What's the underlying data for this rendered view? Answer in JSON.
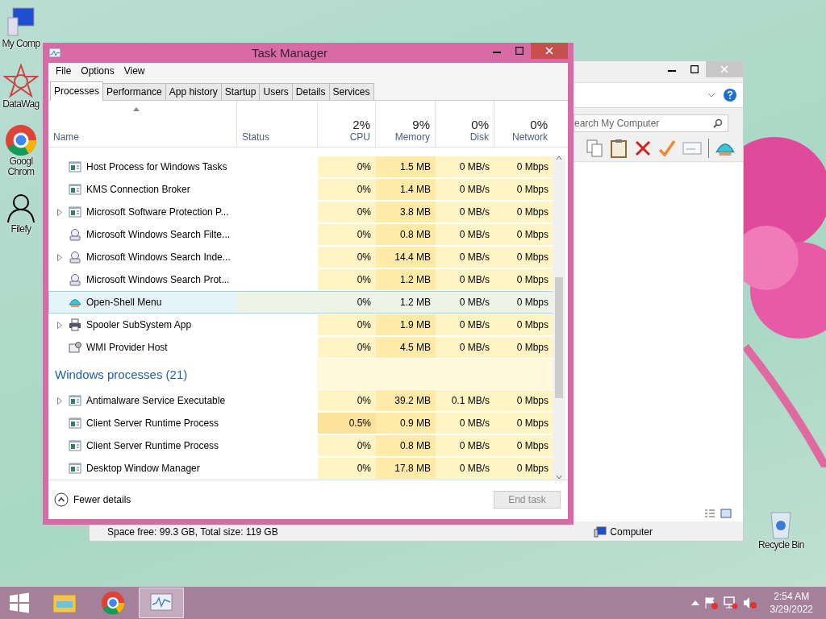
{
  "desktop_icons": [
    {
      "label": "My Comp",
      "kind": "computer"
    },
    {
      "label": "DataWag",
      "kind": "star"
    },
    {
      "label": "Googl\nChrom",
      "kind": "chrome"
    },
    {
      "label": "Filefy",
      "kind": "user"
    }
  ],
  "recycle_bin": {
    "label": "Recycle Bin"
  },
  "explorer": {
    "search": {
      "placeholder": "earch My Computer"
    },
    "status_bar": {
      "space": "Space free: 99.3 GB, Total size: 119 GB",
      "location": "Computer"
    }
  },
  "task_manager": {
    "title": "Task Manager",
    "menu": [
      "File",
      "Options",
      "View"
    ],
    "tabs": [
      {
        "label": "Processes",
        "selected": true
      },
      {
        "label": "Performance",
        "selected": false
      },
      {
        "label": "App history",
        "selected": false
      },
      {
        "label": "Startup",
        "selected": false
      },
      {
        "label": "Users",
        "selected": false
      },
      {
        "label": "Details",
        "selected": false
      },
      {
        "label": "Services",
        "selected": false
      }
    ],
    "columns": [
      {
        "label": "Name"
      },
      {
        "label": "Status"
      },
      {
        "label": "CPU",
        "total": "2%"
      },
      {
        "label": "Memory",
        "total": "9%"
      },
      {
        "label": "Disk",
        "total": "0%"
      },
      {
        "label": "Network",
        "total": "0%"
      }
    ],
    "rows": [
      {
        "kind": "app",
        "name": "Host Process for Windows Tasks",
        "cpu": "0%",
        "memory": "1.5 MB",
        "disk": "0 MB/s",
        "network": "0 Mbps",
        "expandable": false,
        "selected": false
      },
      {
        "kind": "app",
        "name": "KMS Connection Broker",
        "cpu": "0%",
        "memory": "1.4 MB",
        "disk": "0 MB/s",
        "network": "0 Mbps",
        "expandable": false,
        "selected": false
      },
      {
        "kind": "app",
        "name": "Microsoft Software Protection P...",
        "cpu": "0%",
        "memory": "3.8 MB",
        "disk": "0 MB/s",
        "network": "0 Mbps",
        "expandable": true,
        "selected": false
      },
      {
        "kind": "search",
        "name": "Microsoft Windows Search Filte...",
        "cpu": "0%",
        "memory": "0.8 MB",
        "disk": "0 MB/s",
        "network": "0 Mbps",
        "expandable": false,
        "selected": false
      },
      {
        "kind": "search",
        "name": "Microsoft Windows Search Inde...",
        "cpu": "0%",
        "memory": "14.4 MB",
        "disk": "0 MB/s",
        "network": "0 Mbps",
        "expandable": true,
        "selected": false
      },
      {
        "kind": "search",
        "name": "Microsoft Windows Search Prot...",
        "cpu": "0%",
        "memory": "1.2 MB",
        "disk": "0 MB/s",
        "network": "0 Mbps",
        "expandable": false,
        "selected": false
      },
      {
        "kind": "shell",
        "name": "Open-Shell Menu",
        "cpu": "0%",
        "memory": "1.2 MB",
        "disk": "0 MB/s",
        "network": "0 Mbps",
        "expandable": false,
        "selected": true
      },
      {
        "kind": "printer",
        "name": "Spooler SubSystem App",
        "cpu": "0%",
        "memory": "1.9 MB",
        "disk": "0 MB/s",
        "network": "0 Mbps",
        "expandable": true,
        "selected": false
      },
      {
        "kind": "wmi",
        "name": "WMI Provider Host",
        "cpu": "0%",
        "memory": "4.5 MB",
        "disk": "0 MB/s",
        "network": "0 Mbps",
        "expandable": false,
        "selected": false
      },
      {
        "kind": "group",
        "name": "Windows processes (21)"
      },
      {
        "kind": "app",
        "name": "Antimalware Service Executable",
        "cpu": "0%",
        "memory": "39.2 MB",
        "disk": "0.1 MB/s",
        "network": "0 Mbps",
        "expandable": true,
        "selected": false
      },
      {
        "kind": "app",
        "name": "Client Server Runtime Process",
        "cpu": "0.5%",
        "memory": "0.9 MB",
        "disk": "0 MB/s",
        "network": "0 Mbps",
        "expandable": false,
        "selected": false
      },
      {
        "kind": "app",
        "name": "Client Server Runtime Process",
        "cpu": "0%",
        "memory": "0.8 MB",
        "disk": "0 MB/s",
        "network": "0 Mbps",
        "expandable": false,
        "selected": false
      },
      {
        "kind": "app",
        "name": "Desktop Window Manager",
        "cpu": "0%",
        "memory": "17.8 MB",
        "disk": "0 MB/s",
        "network": "0 Mbps",
        "expandable": false,
        "selected": false
      }
    ],
    "fewer_details": "Fewer details",
    "end_task": {
      "label": "End task",
      "disabled": true
    }
  },
  "taskbar": {
    "apps": [
      {
        "kind": "explorer",
        "active": false
      },
      {
        "kind": "chrome",
        "active": false
      },
      {
        "kind": "taskmgr",
        "active": true
      }
    ],
    "time": "2:54 AM",
    "date": "3/29/2022"
  }
}
